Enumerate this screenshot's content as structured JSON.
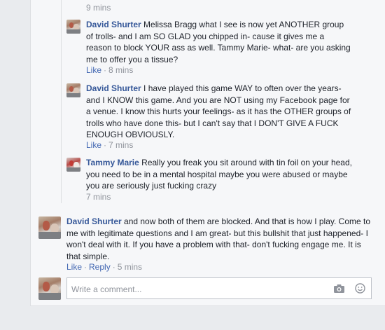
{
  "top_reply_meta": {
    "time": "9 mins"
  },
  "replies": [
    {
      "author": "David Shurter",
      "body": "Melissa Bragg what I see is now yet ANOTHER group of trolls- and I am SO GLAD you chipped in- cause it gives me a reason to block YOUR ass as well. Tammy Marie- what- are you asking me to offer you a tissue?",
      "like_label": "Like",
      "time": "8 mins"
    },
    {
      "author": "David Shurter",
      "body": "I have played this game WAY to often over the years- and I KNOW this game. And you are NOT using my Facebook page for a venue. I know this hurts your feelings- as it has the OTHER groups of trolls who have done this- but I can't say that I DON'T GIVE A FUCK ENOUGH OBVIOUSLY.",
      "like_label": "Like",
      "time": "7 mins"
    },
    {
      "author": "Tammy Marie",
      "body": "Really you freak you sit around with tin foil on your head, you need to be in a mental hospital maybe you were abused or maybe you are seriously just fucking crazy",
      "time": "7 mins"
    }
  ],
  "comment": {
    "author": "David Shurter",
    "body": "and now both of them are blocked. And that is how I play. Come to me with legitimate questions and I am great- but this bullshit that just happened- I won't deal with it. If you have a problem with that- don't fucking engage me. It is that simple.",
    "like_label": "Like",
    "reply_label": "Reply",
    "time": "5 mins"
  },
  "composer": {
    "placeholder": "Write a comment...",
    "icons": [
      "camera-icon",
      "emoji-icon"
    ]
  },
  "colors": {
    "link": "#4267b2",
    "name": "#365899",
    "meta": "#90949c",
    "panel": "#f6f7f9"
  }
}
